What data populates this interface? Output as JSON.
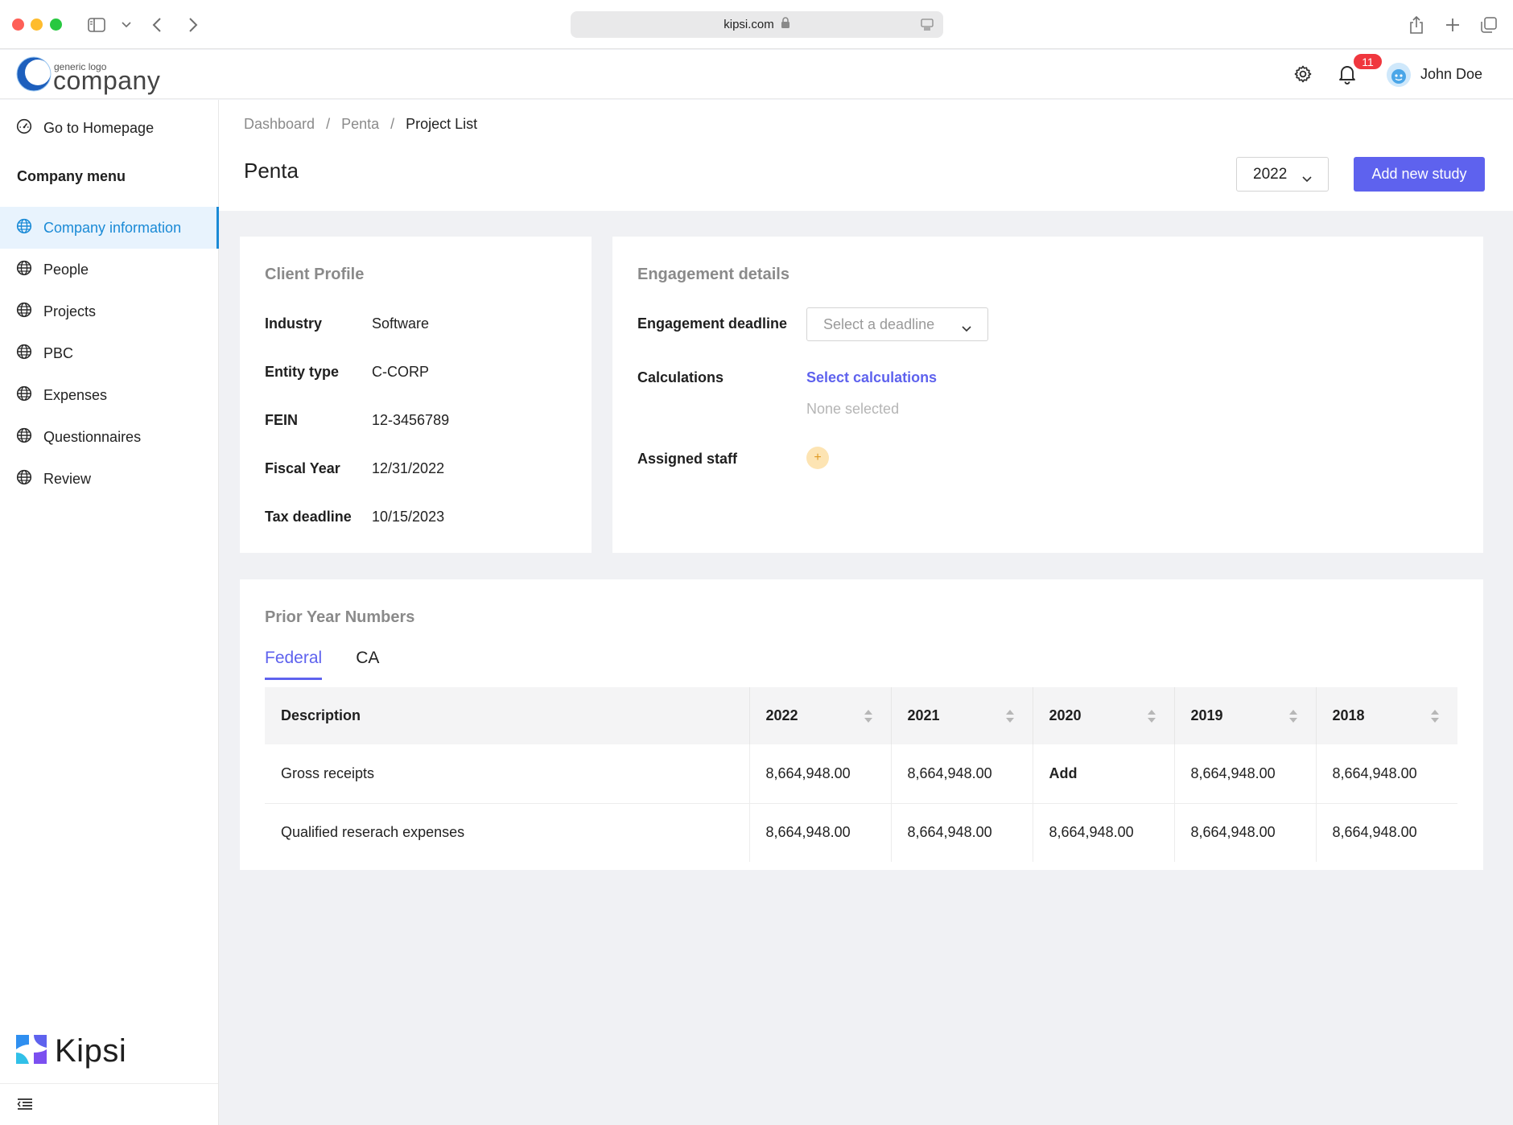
{
  "browser": {
    "url": "kipsi.com"
  },
  "header": {
    "logo_small": "generic logo",
    "logo_big": "company",
    "notification_count": "11",
    "username": "John Doe"
  },
  "sidebar": {
    "home_label": "Go to Homepage",
    "section_title": "Company menu",
    "items": [
      {
        "label": "Company information",
        "icon": "globe-icon",
        "active": true
      },
      {
        "label": "People",
        "icon": "globe-icon"
      },
      {
        "label": "Projects",
        "icon": "globe-icon"
      },
      {
        "label": "PBC",
        "icon": "globe-icon"
      },
      {
        "label": "Expenses",
        "icon": "globe-icon"
      },
      {
        "label": "Questionnaires",
        "icon": "globe-icon"
      },
      {
        "label": "Review",
        "icon": "globe-icon"
      }
    ],
    "brand": "Kipsi"
  },
  "breadcrumb": [
    "Dashboard",
    "Penta",
    "Project List"
  ],
  "page": {
    "title": "Penta",
    "year_selected": "2022",
    "add_button": "Add new study"
  },
  "client_profile": {
    "title": "Client Profile",
    "fields": [
      {
        "label": "Industry",
        "value": "Software"
      },
      {
        "label": "Entity type",
        "value": "C-CORP"
      },
      {
        "label": "FEIN",
        "value": "12-3456789"
      },
      {
        "label": "Fiscal Year",
        "value": "12/31/2022"
      },
      {
        "label": "Tax deadline",
        "value": "10/15/2023"
      }
    ]
  },
  "engagement": {
    "title": "Engagement details",
    "deadline_label": "Engagement deadline",
    "deadline_placeholder": "Select a deadline",
    "calculations_label": "Calculations",
    "calculations_link": "Select calculations",
    "calculations_none": "None selected",
    "staff_label": "Assigned staff",
    "staff_add": "+"
  },
  "prior_year": {
    "title": "Prior Year Numbers",
    "tabs": [
      {
        "label": "Federal",
        "active": true
      },
      {
        "label": "CA"
      }
    ],
    "columns": [
      "Description",
      "2022",
      "2021",
      "2020",
      "2019",
      "2018"
    ],
    "rows": [
      {
        "cells": [
          "Gross receipts",
          "8,664,948.00",
          "8,664,948.00",
          "Add",
          "8,664,948.00",
          "8,664,948.00"
        ]
      },
      {
        "cells": [
          "Qualified reserach expenses",
          "8,664,948.00",
          "8,664,948.00",
          "8,664,948.00",
          "8,664,948.00",
          "8,664,948.00"
        ]
      }
    ]
  },
  "colors": {
    "accent": "#5e62ee",
    "sidebar_active": "#1a8ad6",
    "badge": "#f0373e"
  }
}
